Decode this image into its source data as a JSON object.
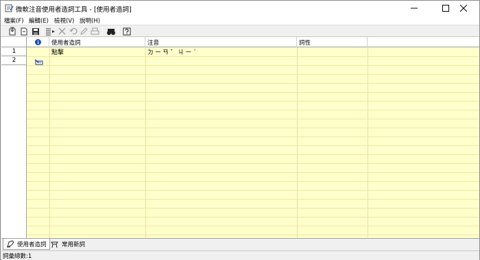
{
  "window": {
    "title": "微軟注音使用者造詞工具 - [使用者造詞]"
  },
  "menu": [
    {
      "label": "檔案(F)"
    },
    {
      "label": "編輯(E)"
    },
    {
      "label": "檢視(V)"
    },
    {
      "label": "說明(H)"
    }
  ],
  "grid": {
    "columns": [
      "",
      "使用者造詞",
      "注音",
      "詞性"
    ],
    "rows": [
      {
        "num": "1",
        "word": "點擊",
        "zhuyin": "ㄉㄧㄢˇ ㄐㄧˊ",
        "pos": ""
      },
      {
        "num": "2",
        "word": "",
        "zhuyin": "",
        "pos": ""
      }
    ]
  },
  "tabs": [
    {
      "label": "使用者造詞"
    },
    {
      "label": "常用新詞"
    }
  ],
  "status": {
    "text": "詞彙總數:1"
  },
  "colors": {
    "grid_bg": "#ffffcc",
    "info_icon": "#1f4fb8"
  }
}
